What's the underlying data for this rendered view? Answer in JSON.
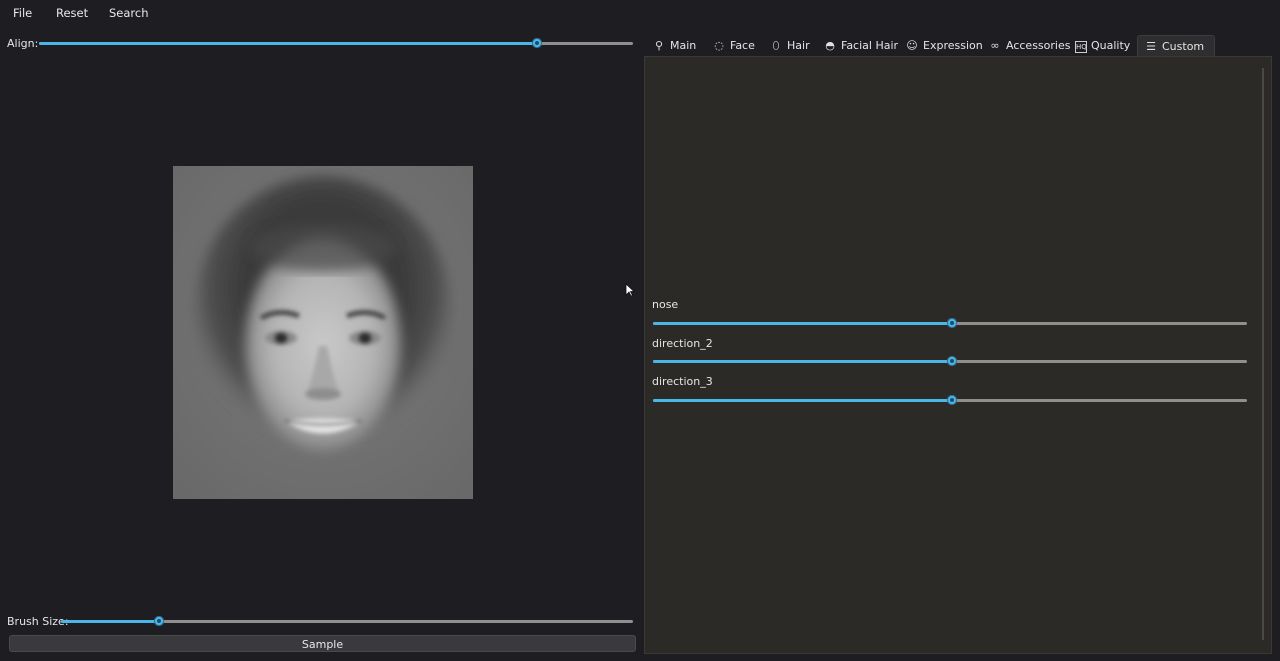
{
  "menu": {
    "file": "File",
    "reset": "Reset",
    "search": "Search"
  },
  "align": {
    "label": "Align:",
    "value_fraction": 0.838
  },
  "image": {
    "description_icon": "face-image"
  },
  "brush": {
    "label": "Brush Size:",
    "value_fraction": 0.171
  },
  "sample_button": "Sample",
  "tabs": [
    {
      "label": "Main",
      "icon": "wand-icon"
    },
    {
      "label": "Face",
      "icon": "face-outline-icon"
    },
    {
      "label": "Hair",
      "icon": "hair-icon"
    },
    {
      "label": "Facial Hair",
      "icon": "beard-icon"
    },
    {
      "label": "Expression",
      "icon": "smiley-icon"
    },
    {
      "label": "Accessories",
      "icon": "glasses-icon"
    },
    {
      "label": "Quality",
      "icon": "hq-icon"
    },
    {
      "label": "Custom",
      "icon": "sliders-icon"
    }
  ],
  "active_tab": "Custom",
  "custom_sliders": [
    {
      "label": "nose",
      "value_fraction": 0.503
    },
    {
      "label": "direction_2",
      "value_fraction": 0.503
    },
    {
      "label": "direction_3",
      "value_fraction": 0.503
    }
  ],
  "colors": {
    "accent": "#4cb6e8",
    "background": "#1e1d21",
    "panel": "#2b2a27"
  }
}
